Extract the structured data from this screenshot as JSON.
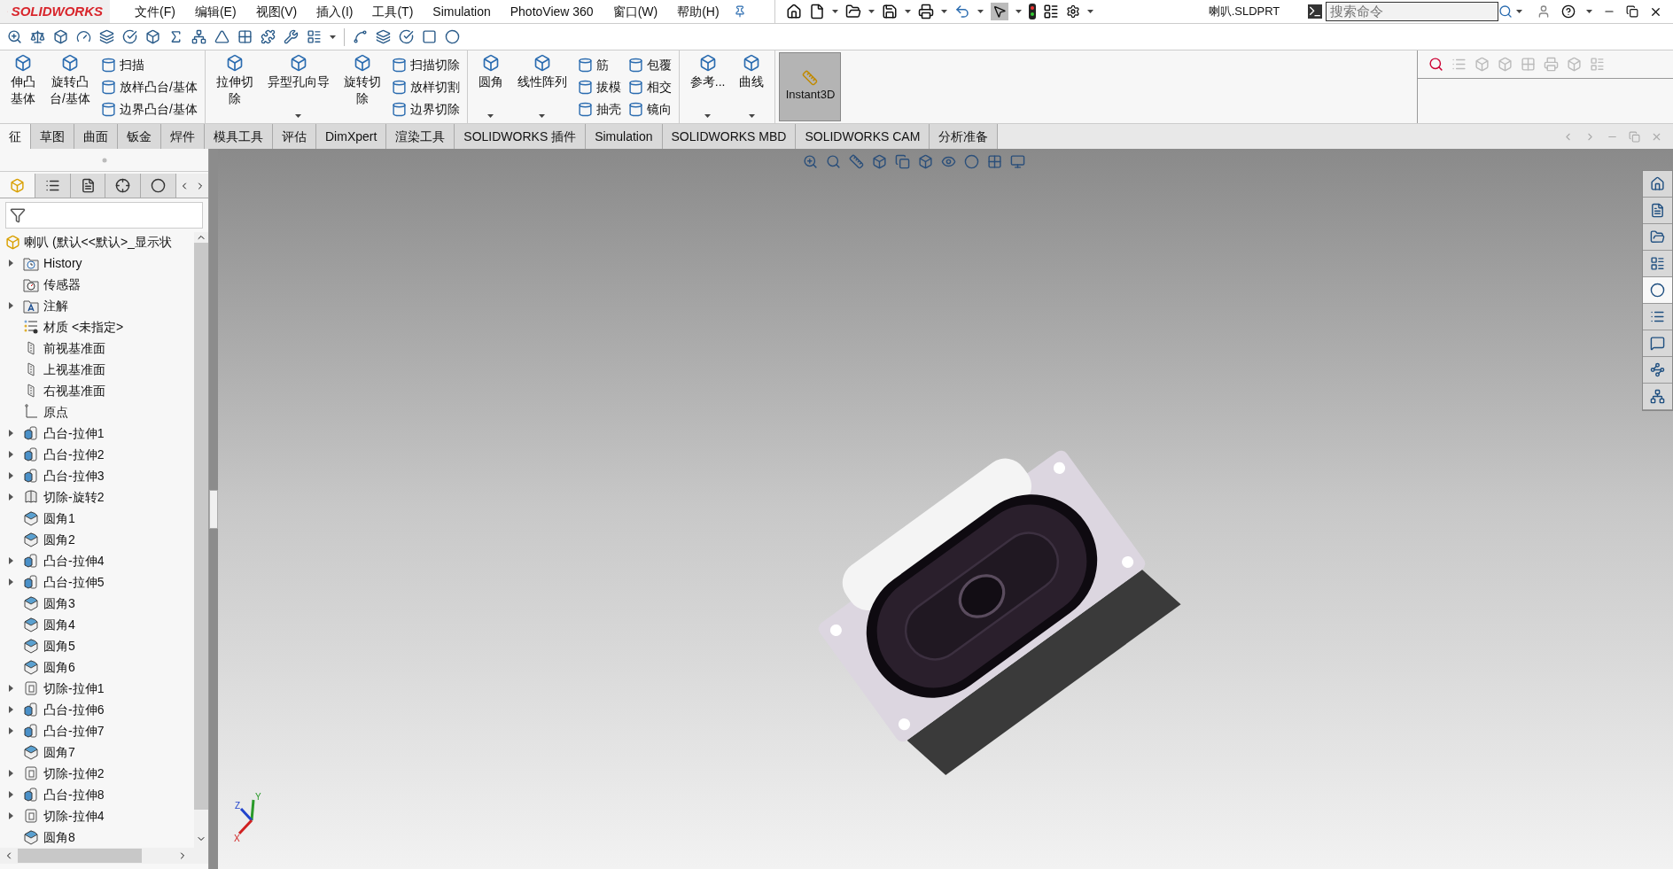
{
  "title_bar": {
    "logo": "SOLIDWORKS",
    "menu": [
      "文件(F)",
      "编辑(E)",
      "视图(V)",
      "插入(I)",
      "工具(T)",
      "Simulation",
      "PhotoView 360",
      "窗口(W)",
      "帮助(H)"
    ],
    "document": "喇叭.SLDPRT",
    "search_placeholder": "搜索命令"
  },
  "ribbon": {
    "groups": [
      {
        "entries": [
          {
            "kind": "large",
            "lines": [
              "伸凸",
              "基体"
            ],
            "dropdown": false
          },
          {
            "kind": "large",
            "lines": [
              "旋转凸",
              "台/基体"
            ],
            "dropdown": false
          },
          {
            "kind": "column",
            "labels": [
              "扫描",
              "放样凸台/基体",
              "边界凸台/基体"
            ]
          }
        ]
      },
      {
        "entries": [
          {
            "kind": "large",
            "lines": [
              "拉伸切",
              "除"
            ],
            "dropdown": false
          },
          {
            "kind": "large",
            "lines": [
              "异型孔向导"
            ],
            "dropdown": true
          },
          {
            "kind": "large",
            "lines": [
              "旋转切",
              "除"
            ],
            "dropdown": false
          },
          {
            "kind": "column",
            "labels": [
              "扫描切除",
              "放样切割",
              "边界切除"
            ]
          }
        ]
      },
      {
        "entries": [
          {
            "kind": "large",
            "lines": [
              "圆角"
            ],
            "dropdown": true
          },
          {
            "kind": "large",
            "lines": [
              "线性阵列"
            ],
            "dropdown": true
          },
          {
            "kind": "column",
            "labels": [
              "筋",
              "拔模",
              "抽壳"
            ]
          },
          {
            "kind": "column",
            "labels": [
              "包覆",
              "相交",
              "镜向"
            ]
          }
        ]
      },
      {
        "entries": [
          {
            "kind": "large",
            "lines": [
              "参考..."
            ],
            "dropdown": true
          },
          {
            "kind": "large",
            "lines": [
              "曲线"
            ],
            "dropdown": true
          }
        ]
      }
    ],
    "instant3d": {
      "label": "Instant3D",
      "selected": true
    }
  },
  "tabs": [
    {
      "label": "征",
      "selected": true
    },
    {
      "label": "草图",
      "selected": false
    },
    {
      "label": "曲面",
      "selected": false
    },
    {
      "label": "钣金",
      "selected": false
    },
    {
      "label": "焊件",
      "selected": false
    },
    {
      "label": "模具工具",
      "selected": false
    },
    {
      "label": "评估",
      "selected": false
    },
    {
      "label": "DimXpert",
      "selected": false
    },
    {
      "label": "渲染工具",
      "selected": false
    },
    {
      "label": "SOLIDWORKS 插件",
      "selected": false
    },
    {
      "label": "Simulation",
      "selected": false
    },
    {
      "label": "SOLIDWORKS MBD",
      "selected": false
    },
    {
      "label": "SOLIDWORKS CAM",
      "selected": false
    },
    {
      "label": "分析准备",
      "selected": false
    }
  ],
  "panel_tabs": [
    {
      "selected": true
    },
    {
      "selected": false
    },
    {
      "selected": false
    },
    {
      "selected": false
    },
    {
      "selected": false
    }
  ],
  "tree": {
    "root": "喇叭  (默认<<默认>_显示状",
    "items": [
      {
        "label": "History",
        "kind": "history",
        "expandable": true
      },
      {
        "label": "传感器",
        "kind": "sensor",
        "expandable": false
      },
      {
        "label": "注解",
        "kind": "annotation",
        "expandable": true
      },
      {
        "label": "材质 <未指定>",
        "kind": "material",
        "expandable": false
      },
      {
        "label": "前视基准面",
        "kind": "plane",
        "expandable": false
      },
      {
        "label": "上视基准面",
        "kind": "plane",
        "expandable": false
      },
      {
        "label": "右视基准面",
        "kind": "plane",
        "expandable": false
      },
      {
        "label": "原点",
        "kind": "origin",
        "expandable": false
      },
      {
        "label": "凸台-拉伸1",
        "kind": "boss",
        "expandable": true
      },
      {
        "label": "凸台-拉伸2",
        "kind": "boss",
        "expandable": true
      },
      {
        "label": "凸台-拉伸3",
        "kind": "boss",
        "expandable": true
      },
      {
        "label": "切除-旋转2",
        "kind": "revolve",
        "expandable": true
      },
      {
        "label": "圆角1",
        "kind": "fillet",
        "expandable": false
      },
      {
        "label": "圆角2",
        "kind": "fillet",
        "expandable": false
      },
      {
        "label": "凸台-拉伸4",
        "kind": "boss",
        "expandable": true
      },
      {
        "label": "凸台-拉伸5",
        "kind": "boss",
        "expandable": true
      },
      {
        "label": "圆角3",
        "kind": "fillet",
        "expandable": false
      },
      {
        "label": "圆角4",
        "kind": "fillet",
        "expandable": false
      },
      {
        "label": "圆角5",
        "kind": "fillet",
        "expandable": false
      },
      {
        "label": "圆角6",
        "kind": "fillet",
        "expandable": false
      },
      {
        "label": "切除-拉伸1",
        "kind": "cut",
        "expandable": true
      },
      {
        "label": "凸台-拉伸6",
        "kind": "boss",
        "expandable": true
      },
      {
        "label": "凸台-拉伸7",
        "kind": "boss",
        "expandable": true
      },
      {
        "label": "圆角7",
        "kind": "fillet",
        "expandable": false
      },
      {
        "label": "切除-拉伸2",
        "kind": "cut",
        "expandable": true
      },
      {
        "label": "凸台-拉伸8",
        "kind": "boss",
        "expandable": true
      },
      {
        "label": "切除-拉伸4",
        "kind": "cut",
        "expandable": true
      },
      {
        "label": "圆角8",
        "kind": "fillet",
        "expandable": false
      }
    ]
  },
  "triad": {
    "axes": [
      "Y",
      "Z",
      "X"
    ]
  },
  "task_pane": [
    {
      "selected": false
    },
    {
      "selected": false
    },
    {
      "selected": false
    },
    {
      "selected": false
    },
    {
      "selected": true
    },
    {
      "selected": false
    },
    {
      "selected": false
    },
    {
      "selected": false
    },
    {
      "selected": false
    }
  ]
}
